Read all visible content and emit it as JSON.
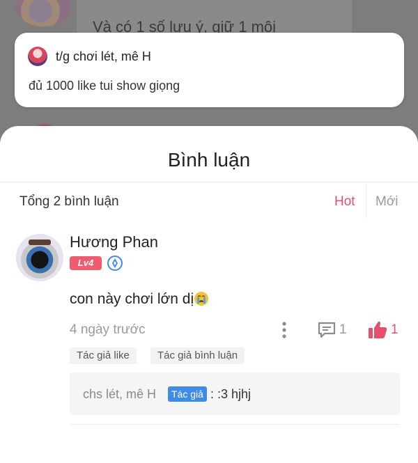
{
  "background": {
    "partial_text": "Và có 1 số lưu ý, giữ 1 môi"
  },
  "quote_card": {
    "title": "t/g chơi lét, mê H",
    "body": "đủ 1000 like tui show giọng"
  },
  "sheet": {
    "title": "Bình luận",
    "total": "Tổng 2 bình luận",
    "sort_options": {
      "hot": "Hot",
      "new": "Mới",
      "selected": "Hot"
    }
  },
  "comment": {
    "author": "Hương Phan",
    "level": "Lv4",
    "text": "con này chơi lớn dị",
    "time": "4 ngày trước",
    "reply_count": "1",
    "like_count": "1",
    "tags": [
      "Tác giả like",
      "Tác giả bình luận"
    ],
    "reply": {
      "user": "chs lét, mê H",
      "badge": "Tác giả",
      "text": ": :3 hjhj"
    }
  },
  "colors": {
    "accent": "#e5506d",
    "author_badge": "#3f8be8",
    "level_badge": "#ef5b71"
  },
  "icons": [
    "verified-icon",
    "crying-emoji-icon",
    "more-options-icon",
    "reply-icon",
    "like-icon"
  ]
}
